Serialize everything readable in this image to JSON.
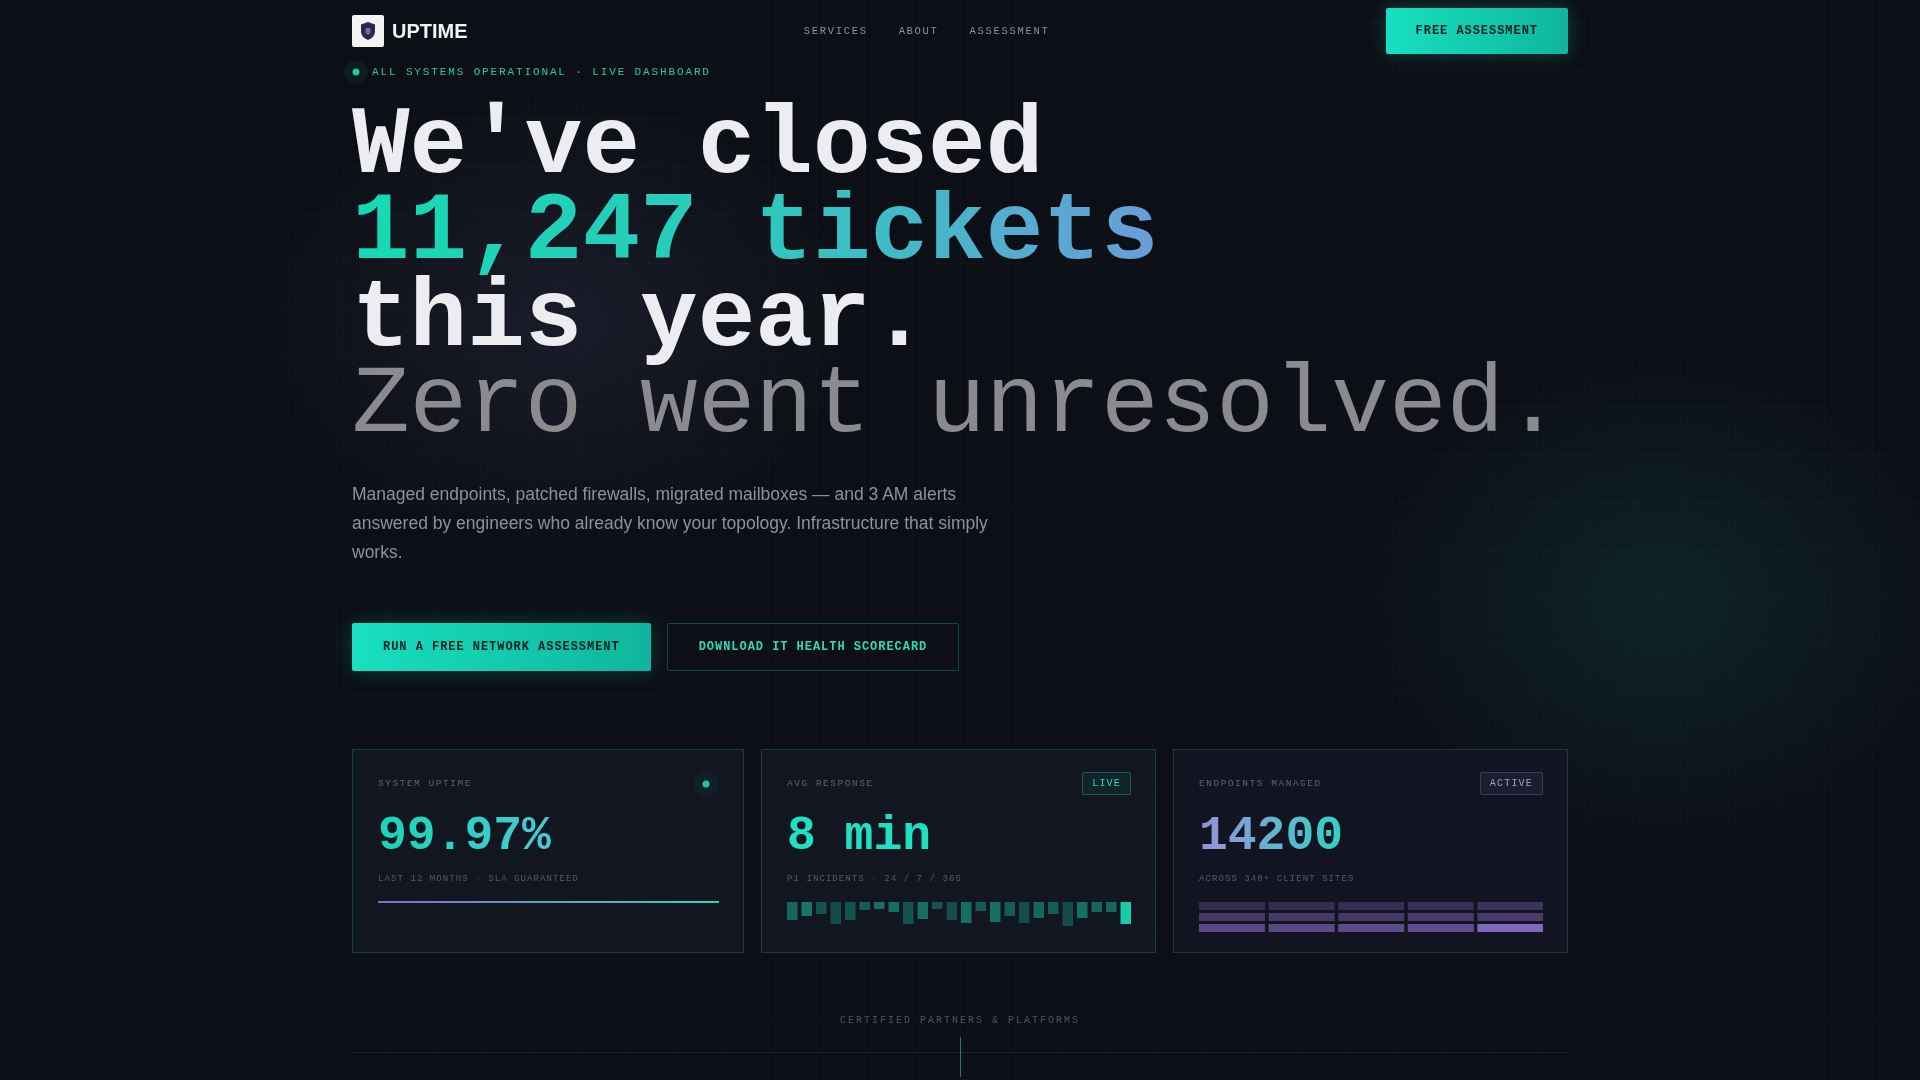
{
  "header": {
    "logo": "UPTIME",
    "nav": [
      {
        "label": "SERVICES"
      },
      {
        "label": "ABOUT"
      },
      {
        "label": "ASSESSMENT"
      }
    ],
    "cta": "FREE ASSESSMENT"
  },
  "status": {
    "text": "ALL SYSTEMS OPERATIONAL · LIVE DASHBOARD"
  },
  "hero": {
    "lines": [
      {
        "text": "We've closed",
        "kind": "plain"
      },
      {
        "text": "11,247 tickets",
        "kind": "accent"
      },
      {
        "text": "this year.",
        "kind": "plain"
      },
      {
        "text": "Zero went unresolved.",
        "kind": "muted"
      }
    ],
    "description": "Managed endpoints, patched firewalls, migrated mailboxes — and 3 AM alerts answered by engineers who already know your topology. Infrastructure that simply works.",
    "buttons": [
      {
        "label": "RUN A FREE NETWORK ASSESSMENT",
        "kind": "primary"
      },
      {
        "label": "DOWNLOAD IT HEALTH SCORECARD",
        "kind": "secondary"
      }
    ]
  },
  "metrics": [
    {
      "kind": "uptime",
      "label": "SYSTEM UPTIME",
      "value": "99.97%",
      "caption": "LAST 12 MONTHS · SLA GUARANTEED"
    },
    {
      "kind": "response",
      "label": "AVG RESPONSE",
      "badge": "LIVE",
      "value": "8 min",
      "caption": "P1 INCIDENTS · 24 / 7 / 365"
    },
    {
      "kind": "endpoints",
      "label": "ENDPOINTS MANAGED",
      "badge": "ACTIVE",
      "value": "14200",
      "caption": "ACROSS 340+ CLIENT SITES"
    }
  ],
  "partners": {
    "title": "CERTIFIED PARTNERS & PLATFORMS"
  }
}
